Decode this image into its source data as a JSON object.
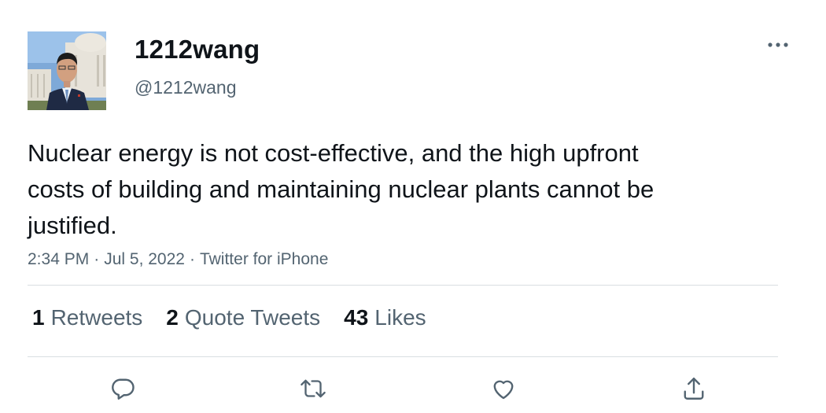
{
  "user": {
    "display_name": "1212wang",
    "handle": "@1212wang",
    "avatar_icon": "profile-photo"
  },
  "tweet": {
    "text": "Nuclear energy is not cost-effective, and the high upfront costs of building and maintaining nuclear plants cannot be justified.",
    "time": "2:34 PM",
    "date": "Jul 5, 2022",
    "source": "Twitter for iPhone",
    "separator": "·"
  },
  "stats": {
    "retweets": {
      "count": "1",
      "label": "Retweets"
    },
    "quote_tweets": {
      "count": "2",
      "label": "Quote Tweets"
    },
    "likes": {
      "count": "43",
      "label": "Likes"
    }
  },
  "actions": {
    "reply_icon": "reply-icon",
    "retweet_icon": "retweet-icon",
    "like_icon": "heart-icon",
    "share_icon": "share-icon",
    "more_icon": "more-options-icon"
  },
  "colors": {
    "text_primary": "#0f1419",
    "text_secondary": "#536471",
    "divider": "#d9dee2",
    "icon": "#536471"
  }
}
